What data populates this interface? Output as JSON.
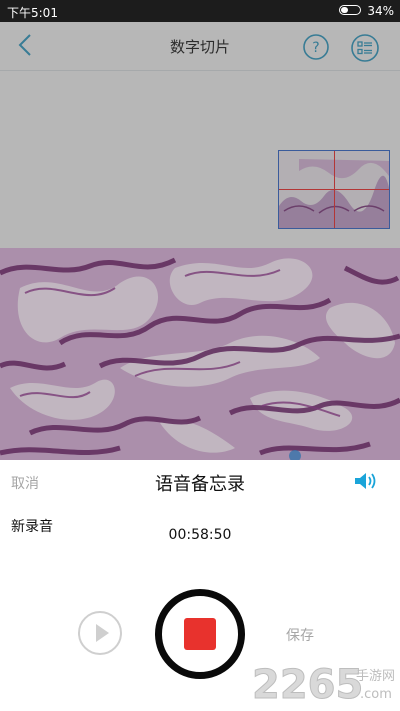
{
  "status_bar": {
    "time": "下午5:01",
    "battery": "34%",
    "battery_level": 0.34
  },
  "header": {
    "title": "数字切片",
    "back_icon": "chevron-left-icon",
    "help_icon": "question-circle-icon",
    "menu_icon": "list-icon"
  },
  "voice_memo": {
    "cancel": "取消",
    "title": "语音备忘录",
    "new_recording": "新录音",
    "timer": "00:58:50",
    "save": "保存",
    "speaker_icon": "speaker-icon",
    "play_icon": "play-icon",
    "stop_icon": "stop-icon"
  },
  "watermark": {
    "number": "2265",
    "domain_top": "手游网",
    "domain_bottom": ".com"
  },
  "colors": {
    "accent": "#2a8cb0",
    "speaker": "#1aa4d9",
    "stop": "#e8322d",
    "tissue_bg": "#c8a8c9",
    "tissue_dark": "#6a2a66"
  }
}
